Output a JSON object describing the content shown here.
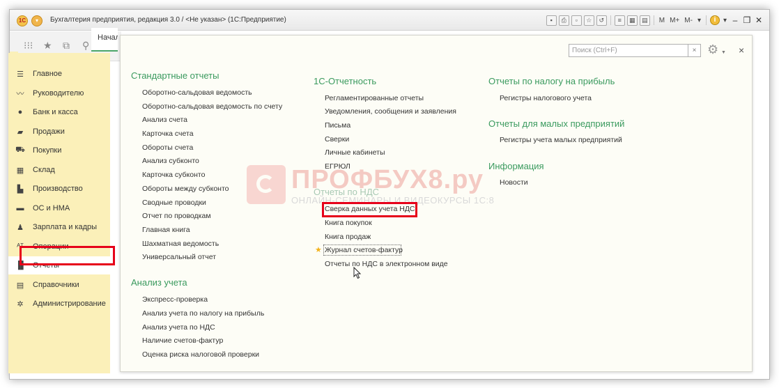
{
  "window": {
    "title": "Бухгалтерия предприятия, редакция 3.0 / <Не указан> (1С:Предприятие)",
    "toolbar_text": [
      "M",
      "M+",
      "M-"
    ]
  },
  "start_tab": {
    "label": "Начальная страница"
  },
  "sidebar": {
    "items": [
      {
        "label": "Главное",
        "icon": "menu-icon"
      },
      {
        "label": "Руководителю",
        "icon": "chart-line-icon"
      },
      {
        "label": "Банк и касса",
        "icon": "ruble-coin-icon"
      },
      {
        "label": "Продажи",
        "icon": "bag-icon"
      },
      {
        "label": "Покупки",
        "icon": "cart-icon"
      },
      {
        "label": "Склад",
        "icon": "warehouse-grid-icon"
      },
      {
        "label": "Производство",
        "icon": "factory-icon"
      },
      {
        "label": "ОС и НМА",
        "icon": "truck-icon"
      },
      {
        "label": "Зарплата и кадры",
        "icon": "person-icon"
      },
      {
        "label": "Операции",
        "icon": "operations-icon"
      },
      {
        "label": "Отчеты",
        "icon": "bar-chart-icon",
        "active": true
      },
      {
        "label": "Справочники",
        "icon": "books-icon"
      },
      {
        "label": "Администрирование",
        "icon": "gear-icon"
      }
    ]
  },
  "search": {
    "placeholder": "Поиск (Ctrl+F)",
    "clear": "×"
  },
  "panel_close": "×",
  "columns": {
    "standard": {
      "title": "Стандартные отчеты",
      "links": [
        "Оборотно-сальдовая ведомость",
        "Оборотно-сальдовая ведомость по счету",
        "Анализ счета",
        "Карточка счета",
        "Обороты счета",
        "Анализ субконто",
        "Карточка субконто",
        "Обороты между субконто",
        "Сводные проводки",
        "Отчет по проводкам",
        "Главная книга",
        "Шахматная ведомость",
        "Универсальный отчет"
      ]
    },
    "analysis": {
      "title": "Анализ учета",
      "links": [
        "Экспресс-проверка",
        "Анализ учета по налогу на прибыль",
        "Анализ учета по НДС",
        "Наличие счетов-фактур",
        "Оценка риска налоговой проверки"
      ]
    },
    "reporting": {
      "title": "1С-Отчетность",
      "links": [
        "Регламентированные отчеты",
        "Уведомления, сообщения и заявления",
        "Письма",
        "Сверки",
        "Личные кабинеты",
        "ЕГРЮЛ"
      ]
    },
    "vat": {
      "title": "Отчеты по НДС",
      "links": [
        "Сверка данных учета НДС",
        "Книга покупок",
        "Книга продаж",
        "Журнал счетов-фактур",
        "Отчеты по НДС в электронном виде"
      ]
    },
    "profit": {
      "title": "Отчеты по налогу на прибыль",
      "links": [
        "Регистры налогового учета"
      ]
    },
    "small": {
      "title": "Отчеты для малых предприятий",
      "links": [
        "Регистры учета малых предприятий"
      ]
    },
    "info": {
      "title": "Информация",
      "links": [
        "Новости"
      ]
    }
  },
  "watermark": {
    "main": "ПРОФБУХ8.ру",
    "sub": "ОНЛАЙН-СЕМИНАРЫ И ВИДЕОКУРСЫ 1С:8"
  }
}
